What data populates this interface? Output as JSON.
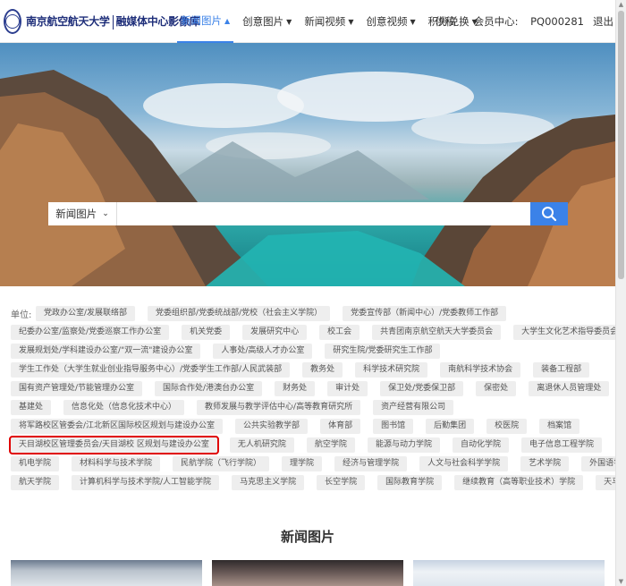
{
  "header": {
    "logo_text_left": "南京航空航天大学",
    "logo_text_right": "融媒体中心影像库",
    "nav": [
      {
        "label": "新闻图片",
        "active": true
      },
      {
        "label": "创意图片",
        "active": false
      },
      {
        "label": "新闻视频",
        "active": false
      },
      {
        "label": "创意视频",
        "active": false
      },
      {
        "label": "积分兑换",
        "active": false
      }
    ],
    "right": {
      "submit": "供稿",
      "member_center": "会员中心:",
      "user_id": "PQ000281",
      "logout": "退出"
    }
  },
  "search": {
    "select_value": "新闻图片",
    "placeholder": "",
    "icon": "search-icon"
  },
  "units": {
    "label": "单位:",
    "rows": [
      [
        "党政办公室/发展联络部",
        "党委组织部/党委统战部/党校（社会主义学院）",
        "党委宣传部（新闻中心）/党委教师工作部"
      ],
      [
        "纪委办公室/监察处/党委巡察工作办公室",
        "机关党委",
        "发展研究中心",
        "校工会",
        "共青团南京航空航天大学委员会",
        "大学生文化艺术指导委员会"
      ],
      [
        "发展规划处/学科建设办公室/\"双一流\"建设办公室",
        "人事处/高级人才办公室",
        "研究生院/党委研究生工作部"
      ],
      [
        "学生工作处（大学生就业创业指导服务中心）/党委学生工作部/人民武装部",
        "教务处",
        "科学技术研究院",
        "南航科学技术协会",
        "装备工程部"
      ],
      [
        "国有资产管理处/节能管理办公室",
        "国际合作处/港澳台办公室",
        "财务处",
        "审计处",
        "保卫处/党委保卫部",
        "保密处",
        "离退休人员管理处"
      ],
      [
        "基建处",
        "信息化处（信息化技术中心）",
        "教师发展与教学评估中心/高等教育研究所",
        "资产经营有限公司"
      ],
      [
        "将军路校区管委会/江北新区国际校区规划与建设办公室",
        "公共实验教学部",
        "体育部",
        "图书馆",
        "后勤集团",
        "校医院",
        "档案馆"
      ],
      [
        "天目湖校区管理委员会/天目湖校 区规划与建设办公室",
        "无人机研究院",
        "航空学院",
        "能源与动力学院",
        "自动化学院",
        "电子信息工程学院"
      ],
      [
        "机电学院",
        "材料科学与技术学院",
        "民航学院（飞行学院）",
        "理学院",
        "经济与管理学院",
        "人文与社会科学学院",
        "艺术学院",
        "外国语学院"
      ],
      [
        "航天学院",
        "计算机科学与技术学院/人工智能学院",
        "马克思主义学院",
        "长空学院",
        "国际教育学院",
        "继续教育（高等职业技术）学院",
        "天马影像"
      ]
    ],
    "highlighted": "天目湖校区管理委员会/天目湖校 区规划与建设办公室"
  },
  "news": {
    "title": "新闻图片"
  },
  "colors": {
    "accent": "#3b82e8",
    "highlight_border": "#e00000",
    "tag_bg": "#eeeeee"
  }
}
